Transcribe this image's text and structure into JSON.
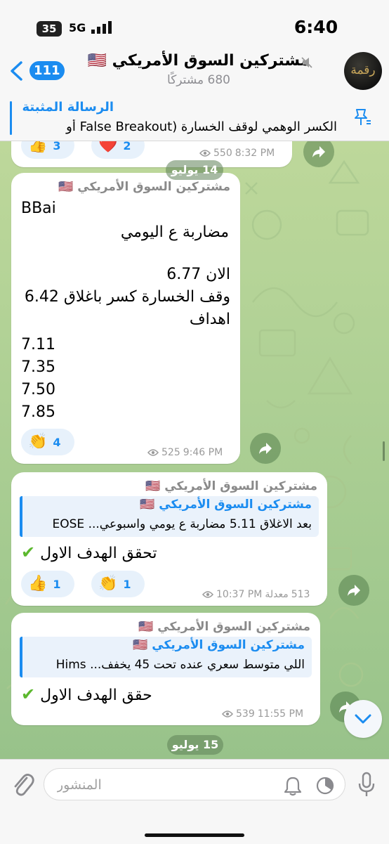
{
  "status_bar": {
    "time": "6:40",
    "battery": "35",
    "network": "5G"
  },
  "header": {
    "back_count": "111",
    "title": "مشتركين السوق الأمريكي 🇺🇸",
    "subscribers": "680 مشتركًا",
    "avatar_text": "رقمة"
  },
  "pinned": {
    "title": "الرسالة المثبتة",
    "text": "الكسر الوهمي لوقف الخسارة (False Breakout أو"
  },
  "messages": {
    "m0": {
      "react1_emoji": "👍",
      "react1_count": "3",
      "react2_emoji": "❤️",
      "react2_count": "2",
      "views": "550",
      "time": "8:32 PM"
    },
    "date1": "14 يوليو",
    "m1": {
      "sender": "مشتركين السوق الأمريكي 🇺🇸",
      "ticker": "BBai",
      "type": "مضاربة ع اليومي",
      "now": "الان 6.77",
      "stop": "وقف الخسارة كسر باغلاق 6.42",
      "targets_label": "اهداف",
      "targets": [
        "7.11",
        "7.35",
        "7.50",
        "7.85"
      ],
      "react_emoji": "👏",
      "react_count": "4",
      "views": "525",
      "time": "9:46 PM"
    },
    "m2": {
      "sender": "مشتركين السوق الأمريكي 🇺🇸",
      "reply_name": "مشتركين السوق الأمريكي 🇺🇸",
      "reply_text": "بعد الاغلاق 5.11 مضاربة ع يومي واسبوعي... EOSE",
      "body": "تحقق الهدف الاول",
      "check": "✔",
      "react1_emoji": "👍",
      "react1_count": "1",
      "react2_emoji": "👏",
      "react2_count": "1",
      "views": "513",
      "edited": "معدلة",
      "time": "10:37 PM"
    },
    "m3": {
      "sender": "مشتركين السوق الأمريكي 🇺🇸",
      "reply_name": "مشتركين السوق الأمريكي 🇺🇸",
      "reply_text": "اللي متوسط سعري عنده تحت 45 يخفف... Hims",
      "body": "حقق الهدف الاول",
      "check": "✔",
      "views": "539",
      "time": "11:55 PM"
    },
    "date2": "15 يوليو"
  },
  "input": {
    "placeholder": "المنشور"
  },
  "colors": {
    "accent": "#1b8cf0",
    "bubble": "#ffffff",
    "wallpaper": "#b4d397",
    "check": "#5cb82e"
  }
}
